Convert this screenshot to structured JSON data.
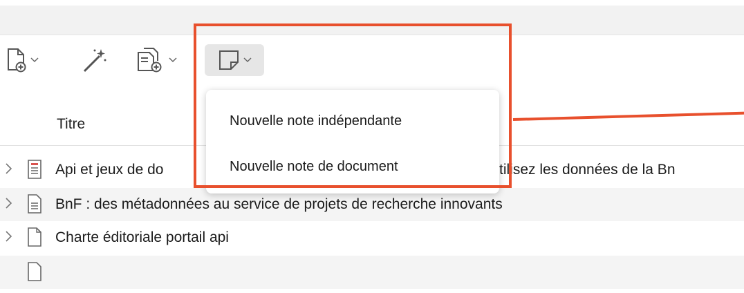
{
  "toolbar": {
    "new_item_icon": "new-item-icon",
    "magic_icon": "magic-wand-icon",
    "add_attachment_icon": "add-attachment-icon",
    "note_icon": "note-icon"
  },
  "note_menu": {
    "items": [
      {
        "label": "Nouvelle note indépendante"
      },
      {
        "label": "Nouvelle note de document"
      }
    ]
  },
  "columns": {
    "title": "Titre"
  },
  "rows": [
    {
      "icon": "report-icon",
      "title": "Api et jeux de do",
      "title_tail": "tilisez les données de la Bn"
    },
    {
      "icon": "document-icon",
      "title": "BnF : des métadonnées au service de projets de recherche innovants"
    },
    {
      "icon": "blank-document-icon",
      "title": "Charte éditoriale portail api"
    }
  ],
  "colors": {
    "highlight": "#e8502d",
    "active_button": "#e6e6e6"
  }
}
